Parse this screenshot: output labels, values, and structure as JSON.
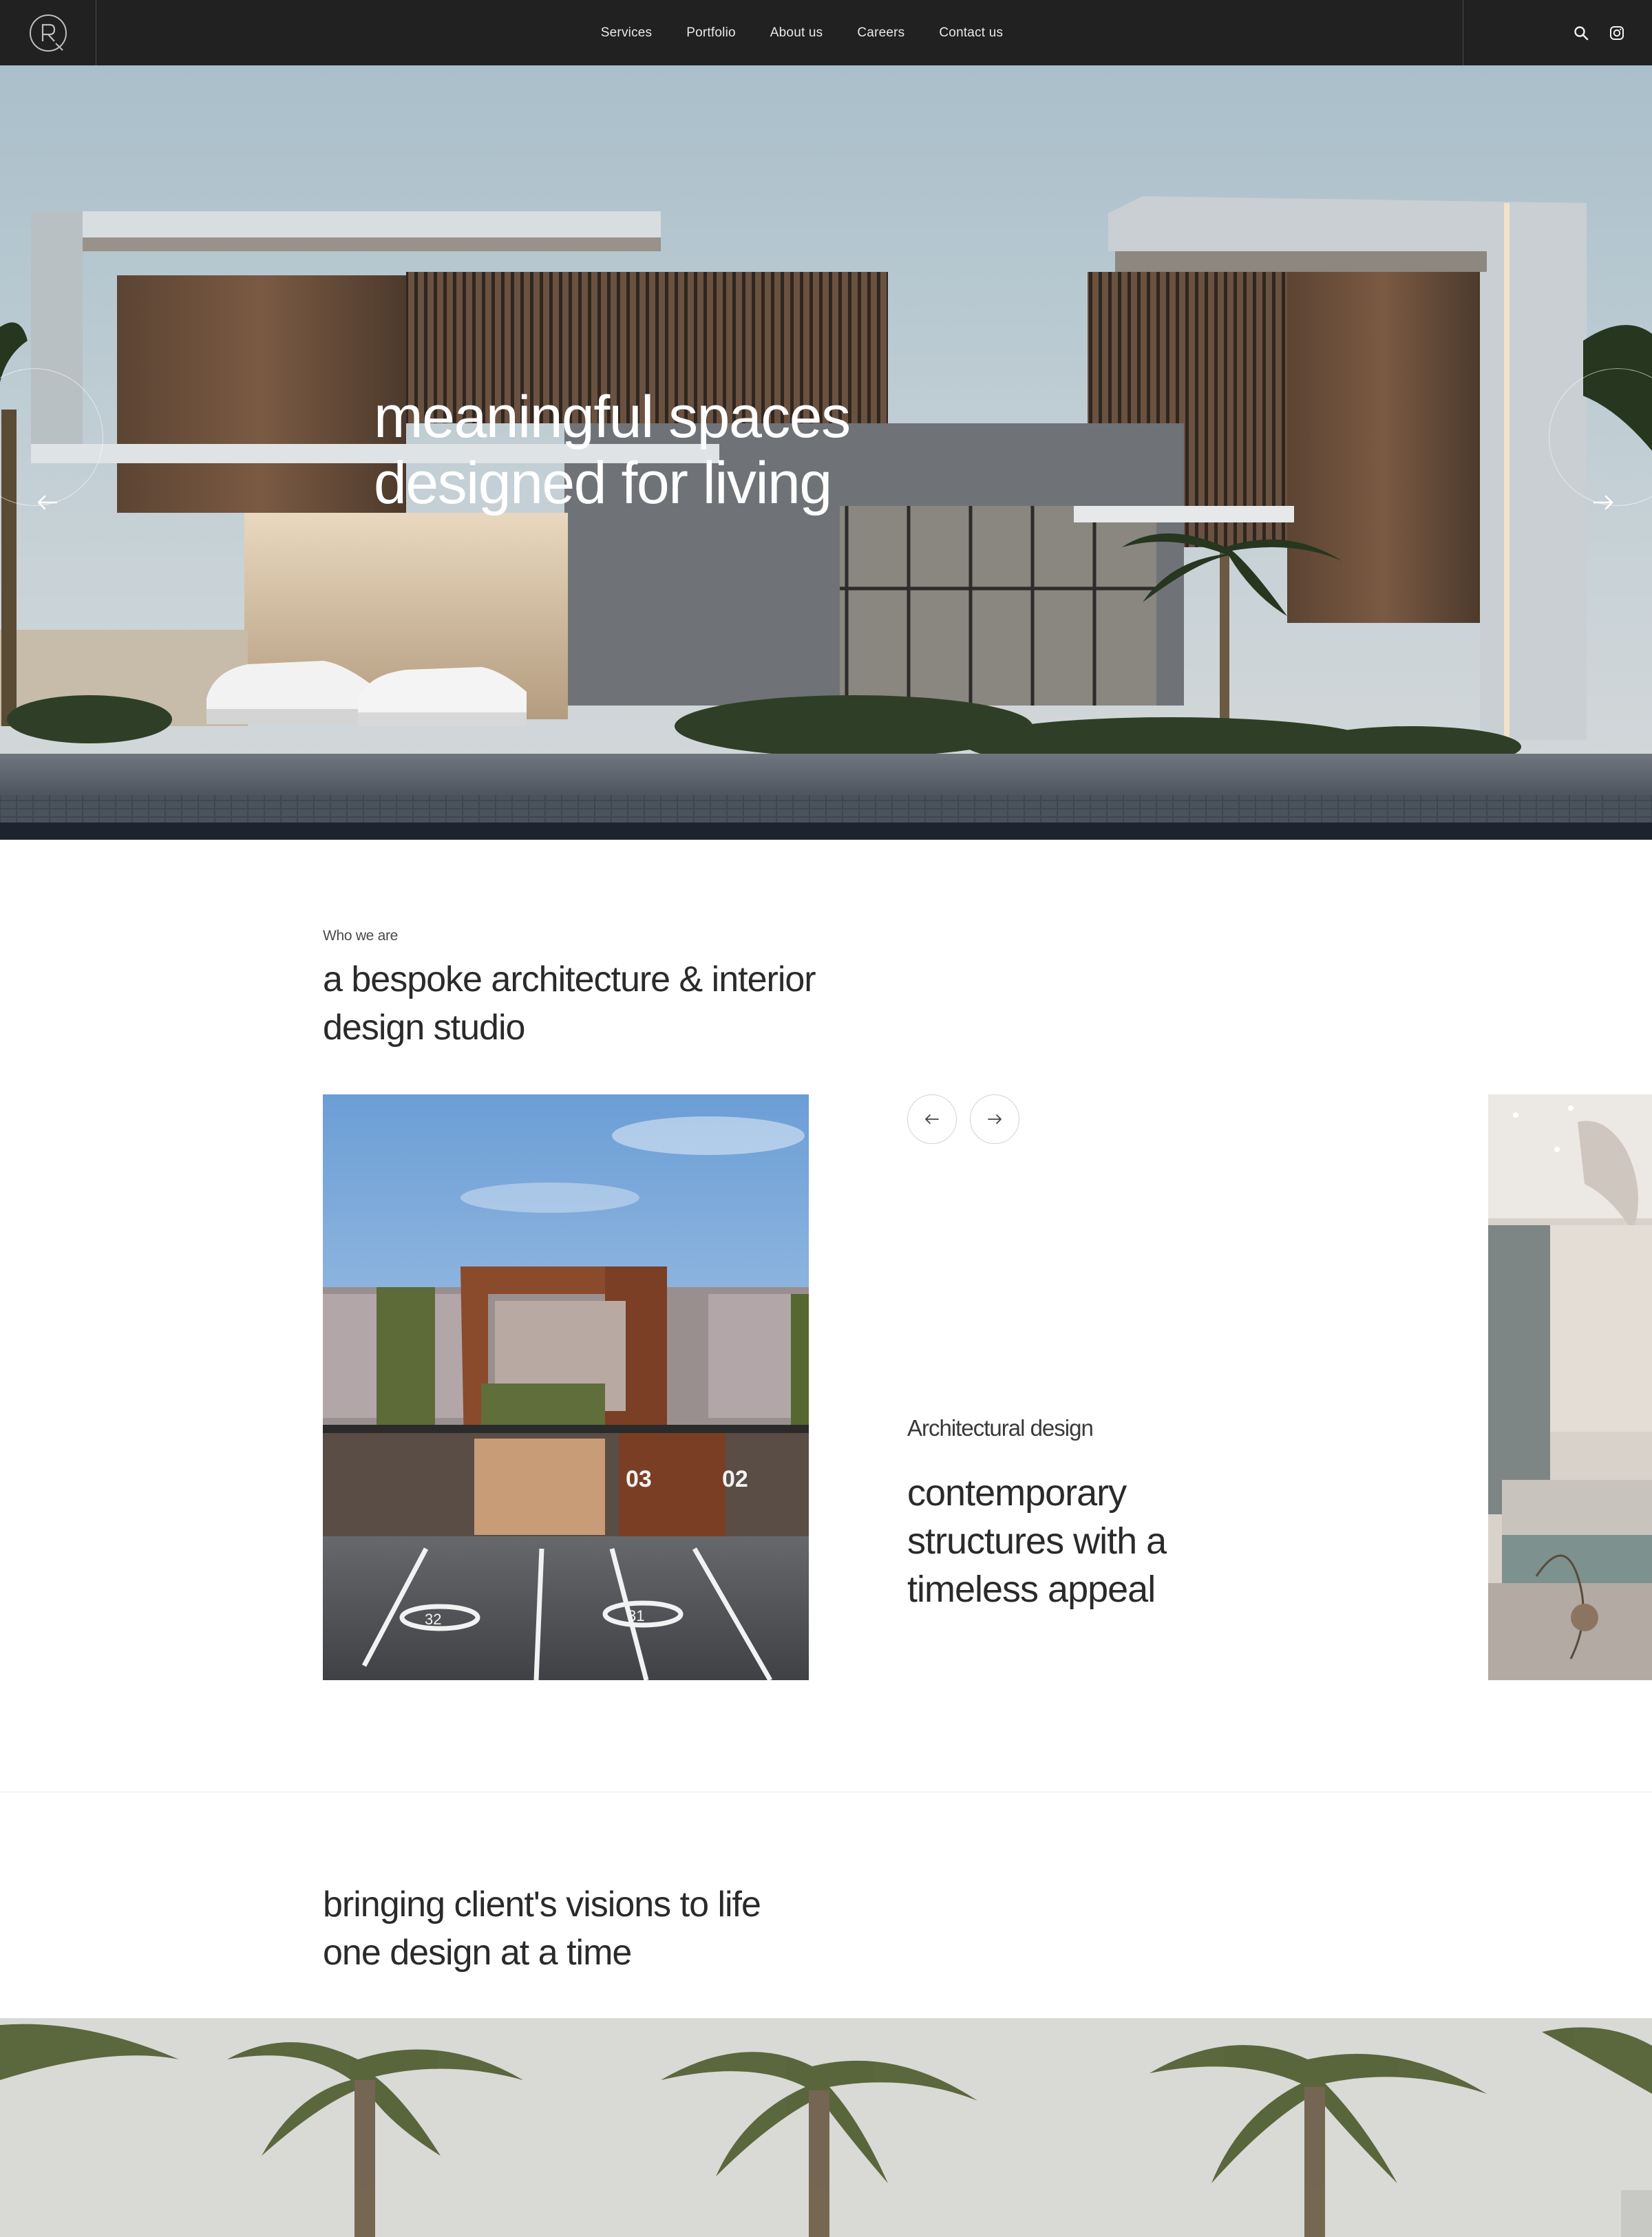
{
  "nav": {
    "menu": [
      {
        "label": "Services"
      },
      {
        "label": "Portfolio"
      },
      {
        "label": "About us"
      },
      {
        "label": "Careers"
      },
      {
        "label": "Contact us"
      }
    ],
    "logo_icon": "r-monogram-logo",
    "search_icon": "search-icon",
    "instagram_icon": "instagram-icon"
  },
  "hero": {
    "title_line1": "meaningful spaces",
    "title_line2": "designed for living",
    "prev_icon": "arrow-left-icon",
    "next_icon": "arrow-right-icon"
  },
  "about": {
    "eyebrow": "Who we are",
    "title_line1": "a bespoke architecture & interior",
    "title_line2": "design studio",
    "slide": {
      "category": "Architectural design",
      "desc_line1": "contemporary",
      "desc_line2": "structures with a",
      "desc_line3": "timeless appeal",
      "unit_numbers": [
        "03",
        "02"
      ],
      "parking_numbers": [
        "32",
        "31"
      ]
    },
    "prev_icon": "arrow-left-icon",
    "next_icon": "arrow-right-icon"
  },
  "vision": {
    "title_line1": "bringing client's visions to life",
    "title_line2": "one design at a time"
  },
  "colors": {
    "nav_bg": "#212121",
    "text_dark": "#2a2a2a",
    "accent_corten": "#8a4a2c"
  }
}
